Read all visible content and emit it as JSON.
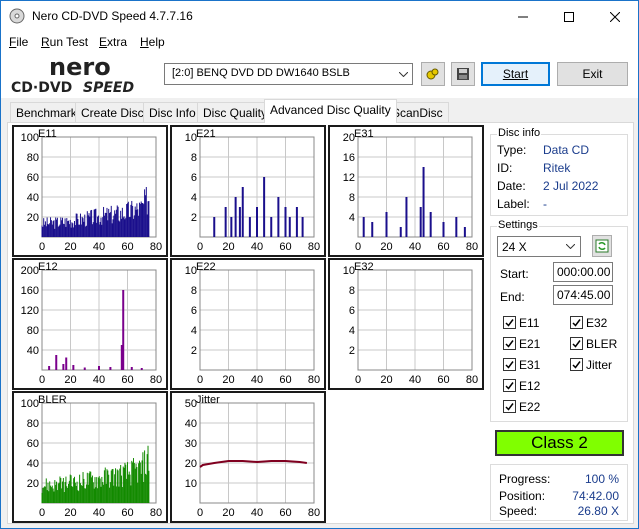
{
  "app": {
    "title": "Nero CD-DVD Speed 4.7.7.16",
    "logo_text_1": "nero",
    "logo_text_2": "CD·DVD",
    "logo_text_3": "SPEED"
  },
  "menu": [
    {
      "label": "File",
      "u": "F",
      "rest": "ile"
    },
    {
      "label": "Run Test",
      "u": "R",
      "rest": "un Test"
    },
    {
      "label": "Extra",
      "u": "E",
      "rest": "xtra"
    },
    {
      "label": "Help",
      "u": "H",
      "rest": "elp"
    }
  ],
  "toolbar": {
    "drive": "[2:0]   BENQ DVD DD DW1640 BSLB",
    "start": "Start",
    "exit": "Exit"
  },
  "tabs": [
    "Benchmark",
    "Create Disc",
    "Disc Info",
    "Disc Quality",
    "Advanced Disc Quality",
    "ScanDisc"
  ],
  "active_tab": "Advanced Disc Quality",
  "disc_info": {
    "title": "Disc info",
    "type_label": "Type:",
    "type": "Data CD",
    "id_label": "ID:",
    "id": "Ritek",
    "date_label": "Date:",
    "date": "2 Jul 2022",
    "label_label": "Label:",
    "label": "-"
  },
  "settings": {
    "title": "Settings",
    "speed": "24 X",
    "start_label": "Start:",
    "start": "000:00.00",
    "end_label": "End:",
    "end": "074:45.00",
    "checks": [
      {
        "label": "E11",
        "checked": true
      },
      {
        "label": "E32",
        "checked": true
      },
      {
        "label": "E21",
        "checked": true
      },
      {
        "label": "BLER",
        "checked": true
      },
      {
        "label": "E31",
        "checked": true
      },
      {
        "label": "Jitter",
        "checked": true
      },
      {
        "label": "E12",
        "checked": true
      },
      {
        "label": "E22",
        "checked": true
      }
    ]
  },
  "result": {
    "class": "Class 2",
    "progress_label": "Progress:",
    "progress": "100 %",
    "position_label": "Position:",
    "position": "74:42.00",
    "speed_label": "Speed:",
    "speed": "26.80 X"
  },
  "colors": {
    "accent": "#0078d7",
    "class_bg": "#80ff00",
    "error_bar": "#1a0f8c",
    "e12_bar": "#7a008c",
    "bler_bar": "#138a00",
    "jitter": "#800020"
  },
  "chart_data": [
    {
      "type": "bar",
      "title": "E11",
      "xlim": [
        0,
        80
      ],
      "ylim": [
        0,
        100
      ],
      "yticks": [
        20,
        40,
        60,
        80,
        100
      ],
      "xticks": [
        0,
        20,
        40,
        60,
        80
      ],
      "x": [
        0,
        10,
        20,
        30,
        40,
        50,
        60,
        70,
        75
      ],
      "values": [
        15,
        16,
        18,
        20,
        23,
        25,
        28,
        32,
        45
      ]
    },
    {
      "type": "bar",
      "title": "E21",
      "xlim": [
        0,
        80
      ],
      "ylim": [
        0,
        10
      ],
      "yticks": [
        2,
        4,
        6,
        8,
        10
      ],
      "xticks": [
        0,
        20,
        40,
        60,
        80
      ],
      "x": [
        10,
        18,
        22,
        25,
        28,
        30,
        35,
        40,
        45,
        50,
        55,
        60,
        63,
        68,
        72
      ],
      "values": [
        2,
        3,
        2,
        4,
        3,
        5,
        2,
        3,
        6,
        2,
        4,
        3,
        2,
        3,
        2
      ]
    },
    {
      "type": "bar",
      "title": "E31",
      "xlim": [
        0,
        80
      ],
      "ylim": [
        0,
        20
      ],
      "yticks": [
        4,
        8,
        12,
        16,
        20
      ],
      "xticks": [
        0,
        20,
        40,
        60,
        80
      ],
      "x": [
        4,
        10,
        20,
        30,
        34,
        44,
        46,
        51,
        60,
        69,
        75
      ],
      "values": [
        4,
        3,
        5,
        2,
        8,
        6,
        14,
        5,
        3,
        4,
        2
      ]
    },
    {
      "type": "bar",
      "title": "E12",
      "xlim": [
        0,
        80
      ],
      "ylim": [
        0,
        200
      ],
      "yticks": [
        40,
        80,
        120,
        160,
        200
      ],
      "xticks": [
        0,
        20,
        40,
        60,
        80
      ],
      "x": [
        5,
        10,
        15,
        17,
        22,
        30,
        40,
        48,
        56,
        57,
        63,
        70
      ],
      "values": [
        8,
        30,
        12,
        25,
        10,
        5,
        8,
        6,
        50,
        160,
        6,
        4
      ]
    },
    {
      "type": "bar",
      "title": "E22",
      "xlim": [
        0,
        80
      ],
      "ylim": [
        0,
        10
      ],
      "yticks": [
        2,
        4,
        6,
        8,
        10
      ],
      "xticks": [
        0,
        20,
        40,
        60,
        80
      ],
      "x": [],
      "values": []
    },
    {
      "type": "bar",
      "title": "E32",
      "xlim": [
        0,
        80
      ],
      "ylim": [
        0,
        10
      ],
      "yticks": [
        2,
        4,
        6,
        8,
        10
      ],
      "xticks": [
        0,
        20,
        40,
        60,
        80
      ],
      "x": [],
      "values": []
    },
    {
      "type": "bar",
      "title": "BLER",
      "xlim": [
        0,
        80
      ],
      "ylim": [
        0,
        100
      ],
      "yticks": [
        20,
        40,
        60,
        80,
        100
      ],
      "xticks": [
        0,
        20,
        40,
        60,
        80
      ],
      "x": [
        0,
        10,
        20,
        30,
        40,
        50,
        60,
        70,
        75
      ],
      "values": [
        20,
        20,
        22,
        25,
        27,
        30,
        33,
        38,
        50
      ]
    },
    {
      "type": "line",
      "title": "Jitter",
      "xlim": [
        0,
        80
      ],
      "ylim": [
        0,
        50
      ],
      "yticks": [
        10,
        20,
        30,
        40,
        50
      ],
      "xticks": [
        0,
        20,
        40,
        60,
        80
      ],
      "x": [
        0,
        2,
        10,
        20,
        30,
        40,
        50,
        60,
        70,
        75
      ],
      "values": [
        18,
        19,
        20,
        21,
        21,
        20.5,
        21,
        21,
        20.5,
        20
      ]
    }
  ]
}
